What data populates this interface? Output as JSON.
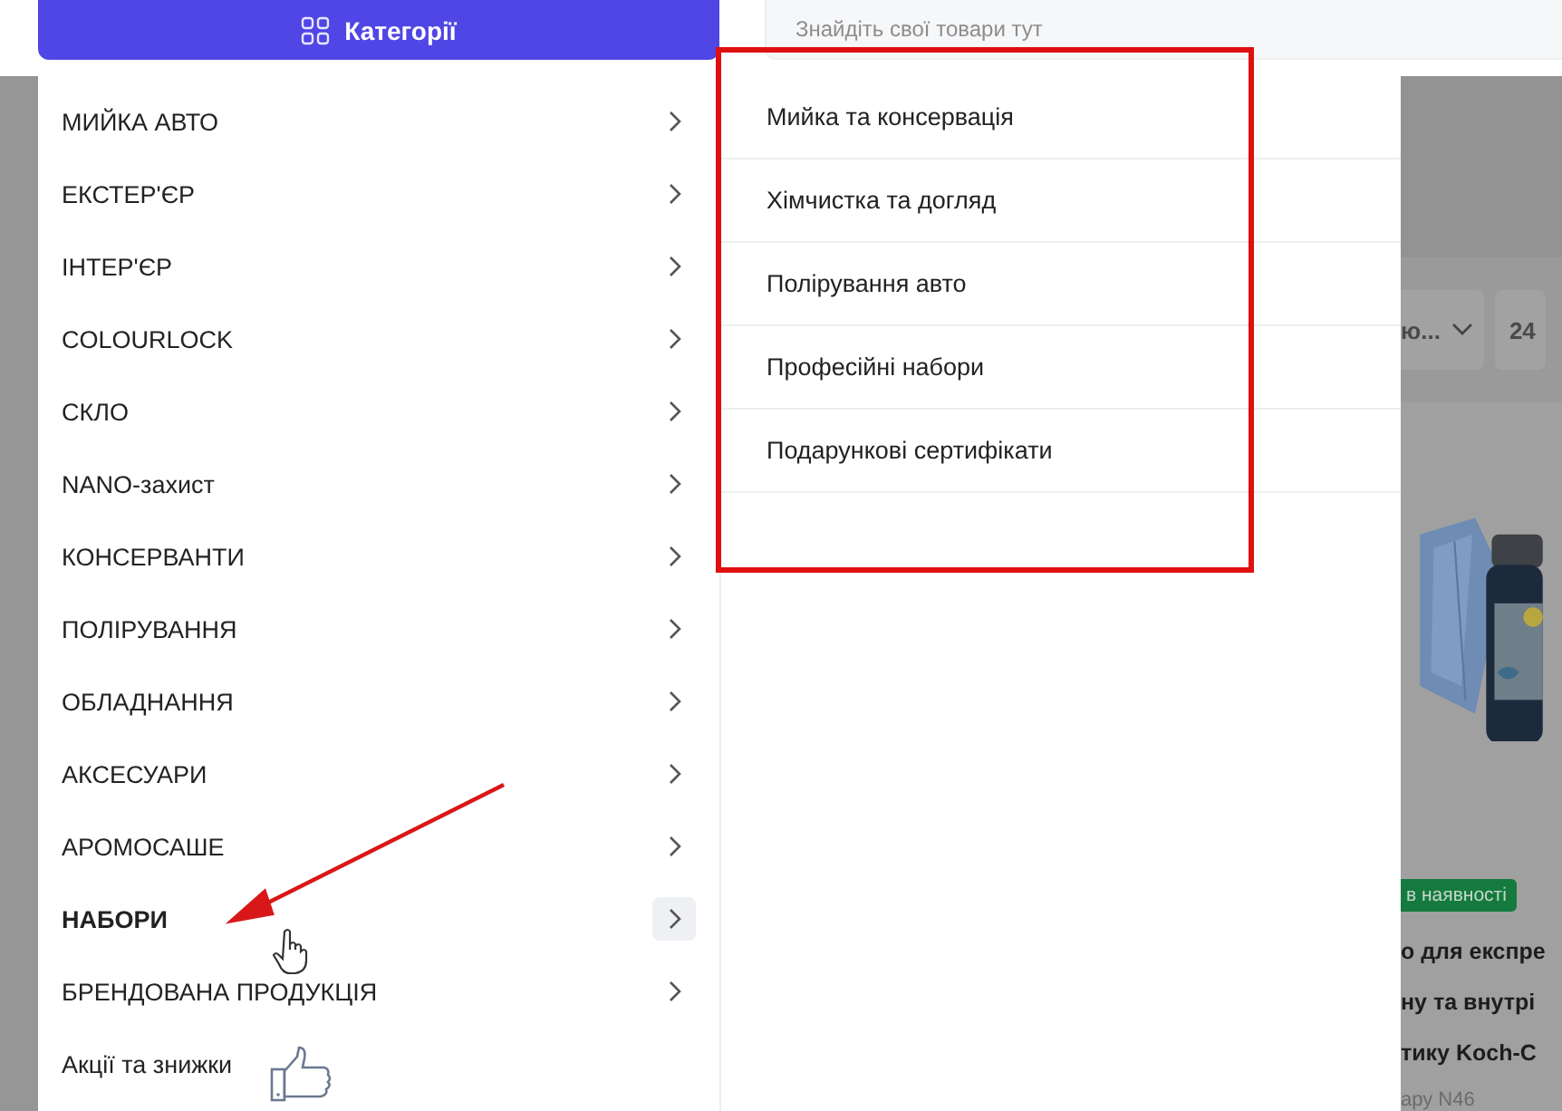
{
  "header": {
    "categories_button": "Категорії",
    "search": {
      "placeholder": "Знайдіть свої товари тут"
    }
  },
  "menu": {
    "items": [
      {
        "label": "МИЙКА АВТО",
        "selected": false,
        "kind": "submenu"
      },
      {
        "label": "ЕКСТЕР'ЄР",
        "selected": false,
        "kind": "submenu"
      },
      {
        "label": "ІНТЕР'ЄР",
        "selected": false,
        "kind": "submenu"
      },
      {
        "label": "COLOURLOCK",
        "selected": false,
        "kind": "submenu"
      },
      {
        "label": "СКЛО",
        "selected": false,
        "kind": "submenu"
      },
      {
        "label": "NANO-захист",
        "selected": false,
        "kind": "submenu"
      },
      {
        "label": "КОНСЕРВАНТИ",
        "selected": false,
        "kind": "submenu"
      },
      {
        "label": "ПОЛІРУВАННЯ",
        "selected": false,
        "kind": "submenu"
      },
      {
        "label": "ОБЛАДНАННЯ",
        "selected": false,
        "kind": "submenu"
      },
      {
        "label": "АКСЕСУАРИ",
        "selected": false,
        "kind": "submenu"
      },
      {
        "label": "АРОМОСАШЕ",
        "selected": false,
        "kind": "submenu"
      },
      {
        "label": "НАБОРИ",
        "selected": true,
        "kind": "submenu"
      },
      {
        "label": "БРЕНДОВАНА ПРОДУКЦІЯ",
        "selected": false,
        "kind": "submenu"
      },
      {
        "label": "Акції та знижки",
        "selected": false,
        "kind": "link"
      }
    ]
  },
  "submenu": {
    "items": [
      "Мийка та консервація",
      "Хімчистка та догляд",
      "Полірування авто",
      "Професійні набори",
      "Подарункові сертифікати"
    ]
  },
  "background_page": {
    "sort_select": "ю...",
    "per_page": "24",
    "product": {
      "kind": "picture",
      "badge": "в наявності",
      "title_lines": [
        "о для експре",
        "ну та внутрі",
        "тику Koch-C"
      ],
      "code": "ару N46"
    }
  }
}
